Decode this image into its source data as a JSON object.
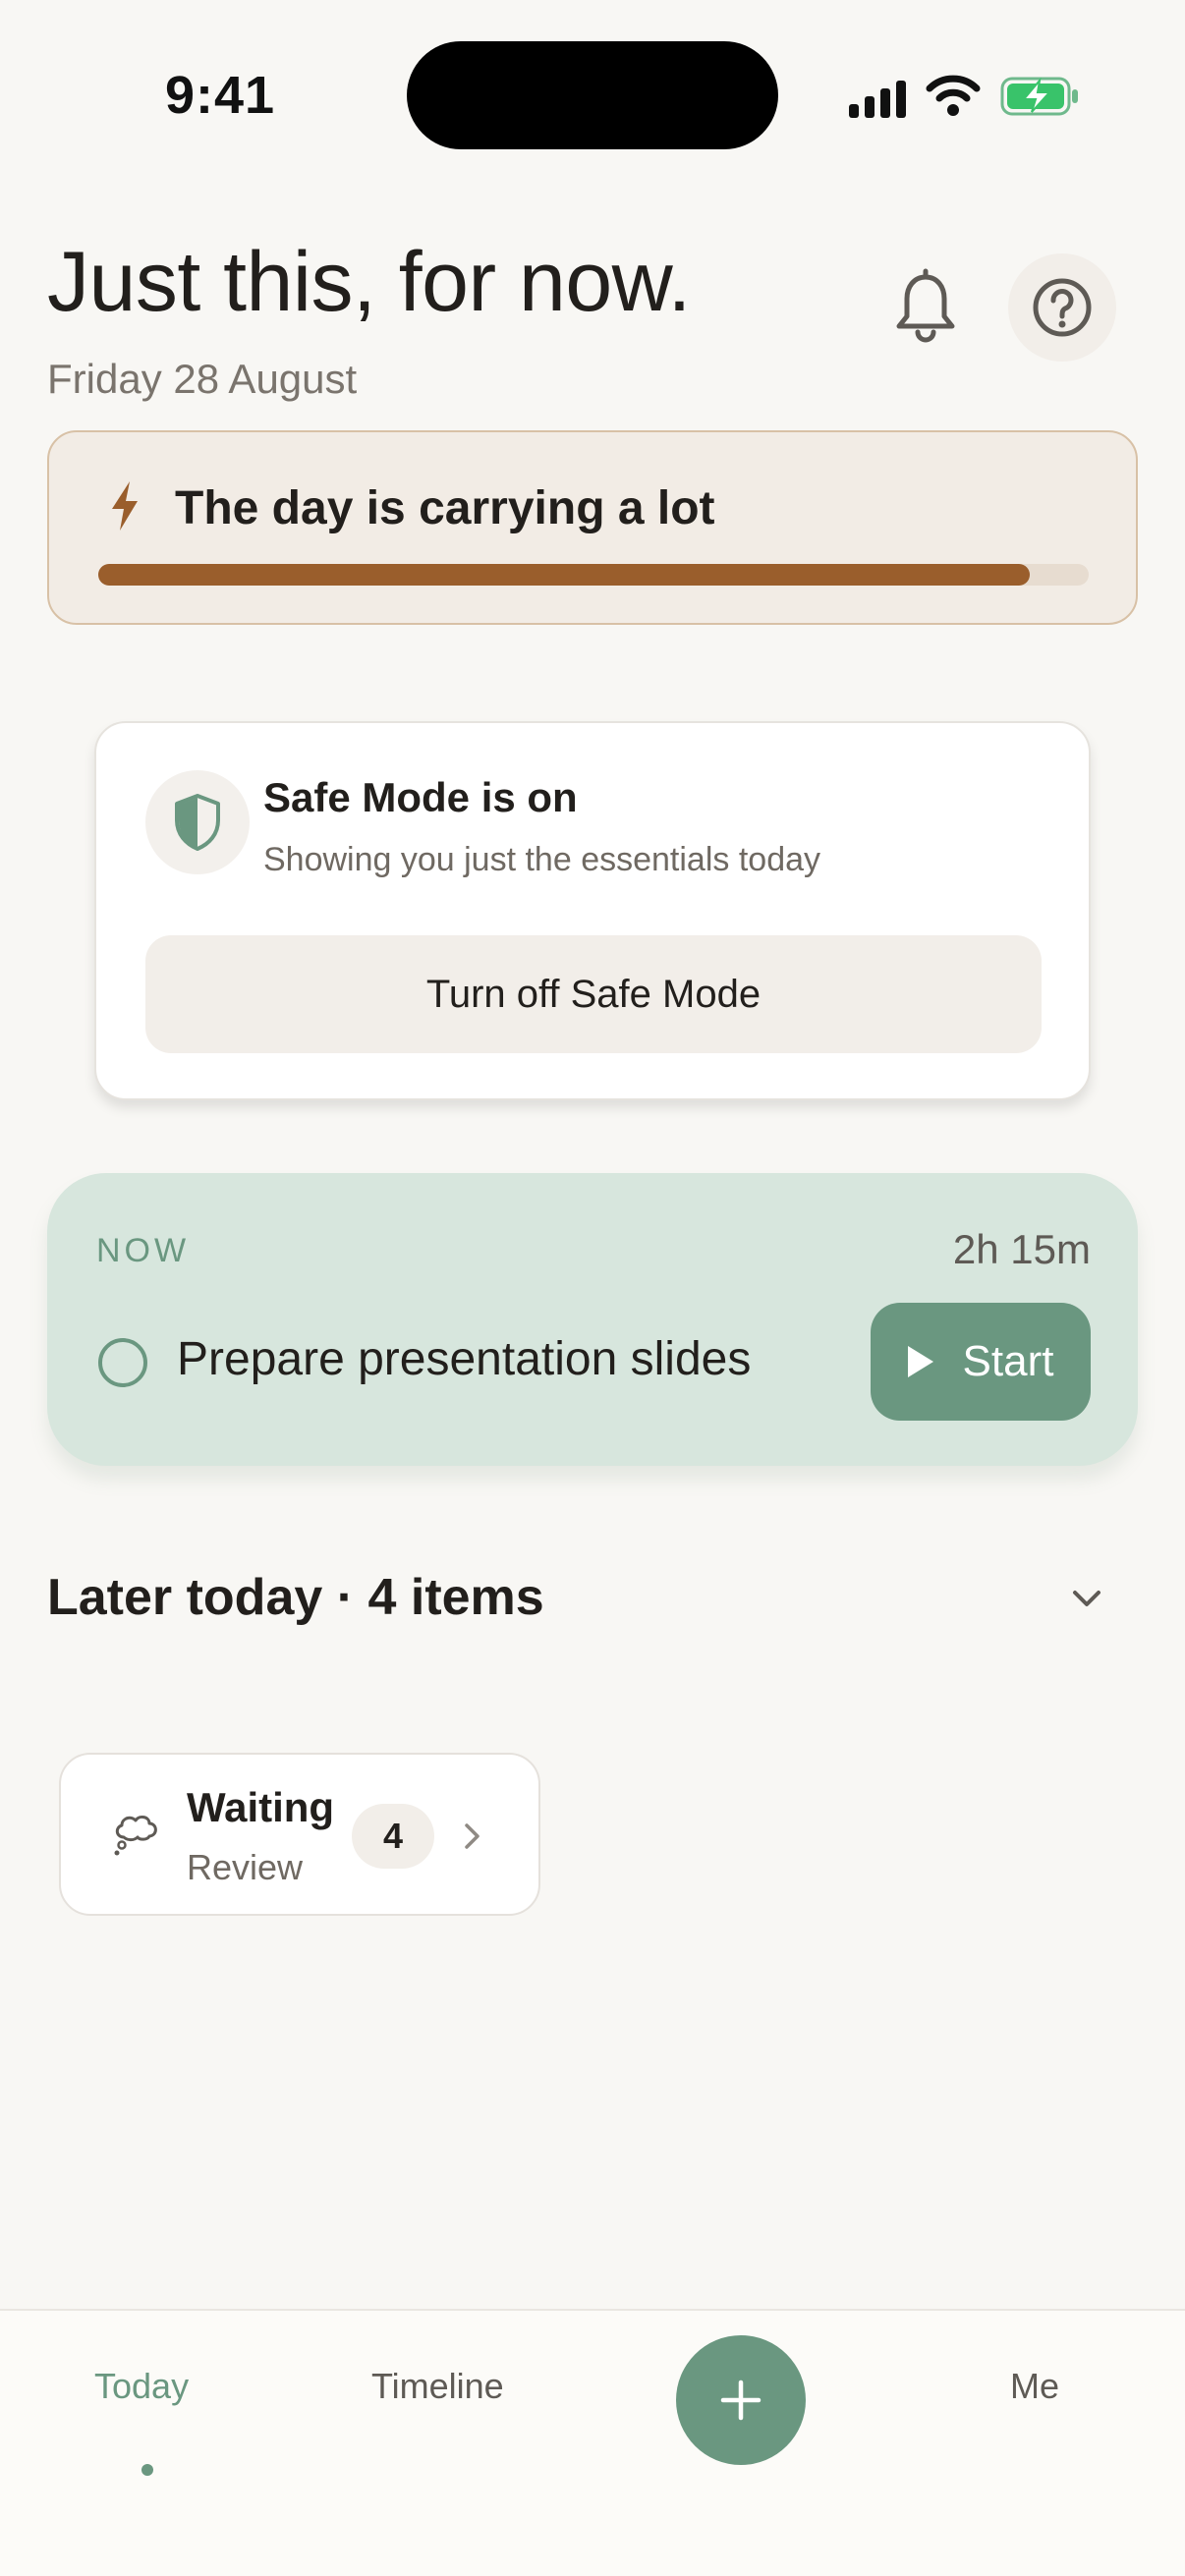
{
  "status_bar": {
    "time": "9:41",
    "icons": [
      "signal-icon",
      "wifi-icon",
      "battery-charging-icon"
    ]
  },
  "header": {
    "title": "Just this, for now.",
    "date": "Friday 28 August",
    "icons": [
      "bell-icon",
      "help-icon"
    ]
  },
  "load": {
    "title": "The day is carrying a lot",
    "level": 0.94,
    "icon": "bolt-icon",
    "colors": {
      "fill": "#9a5e2c",
      "track": "#e7dcd0",
      "border": "#d8c1a6"
    }
  },
  "safe_mode": {
    "title": "Safe Mode is on",
    "subtitle": "Showing you just the essentials today",
    "button_label": "Turn off Safe Mode",
    "icon": "shield-icon"
  },
  "now": {
    "label": "NOW",
    "duration": "2h 15m",
    "task": "Prepare presentation slides",
    "start_label": "Start",
    "colors": {
      "card": "#d7e6dd",
      "accent": "#6a9780"
    }
  },
  "later": {
    "title": "Later today · 4 items",
    "icon": "chevron-down-icon"
  },
  "waiting": {
    "title": "Waiting",
    "subtitle": "Review",
    "count": "4",
    "icon": "thought-cloud-icon"
  },
  "nav": {
    "today": "Today",
    "timeline": "Timeline",
    "me": "Me",
    "active": "Today",
    "add_icon": "plus-icon"
  }
}
